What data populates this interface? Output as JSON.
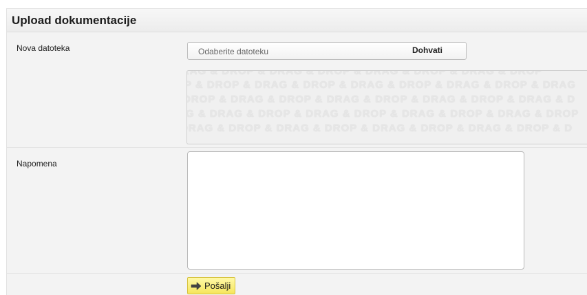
{
  "panel": {
    "title": "Upload dokumentacije"
  },
  "file_row": {
    "label": "Nova datoteka",
    "placeholder": "Odaberite datoteku",
    "fetch_label": "Dohvati",
    "dropzone_lines": [
      "DRAG & DROP & DRAG & DROP & DRAG & DROP & DRAG & DROP",
      "P & DROP & DRAG & DROP & DRAG & DROP & DRAG & DROP & DRAG",
      "DROP & DRAG & DROP & DRAG & DROP & DRAG & DROP & DRAG & D",
      "G & DRAG & DROP & DRAG & DROP & DRAG & DROP & DRAG & DROP",
      "DRAG & DROP & DRAG & DROP & DRAG & DROP & DRAG & DROP & D"
    ]
  },
  "note_row": {
    "label": "Napomena",
    "value": ""
  },
  "actions": {
    "send_label": "Pošalji",
    "send_icon": "arrow-right-icon"
  },
  "colors": {
    "send_button": "#f6e65c",
    "panel_background": "#f3f3f3"
  }
}
